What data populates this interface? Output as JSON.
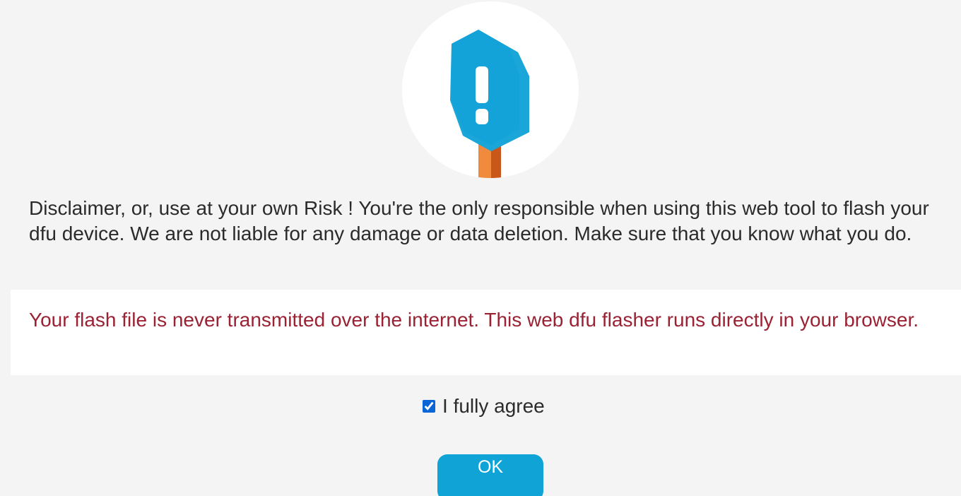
{
  "logo": {
    "icon": "exclamation-sign-logo",
    "colors": {
      "sign_front": "#1aa6d9",
      "sign_side": "#1683ad",
      "post": "#e0732a"
    }
  },
  "disclaimer": {
    "text": "Disclaimer, or, use at your own Risk ! You're the only responsible when using this web tool to flash your dfu device. We are not liable for any damage or data deletion. Make sure that you know what you do."
  },
  "notice": {
    "text": "Your flash file is never transmitted over the internet. This web dfu flasher runs directly in your browser.",
    "color": "#9a2233"
  },
  "agree": {
    "label": "I fully agree",
    "checked": true
  },
  "ok_button": {
    "label": "OK",
    "color": "#10a3d6"
  }
}
